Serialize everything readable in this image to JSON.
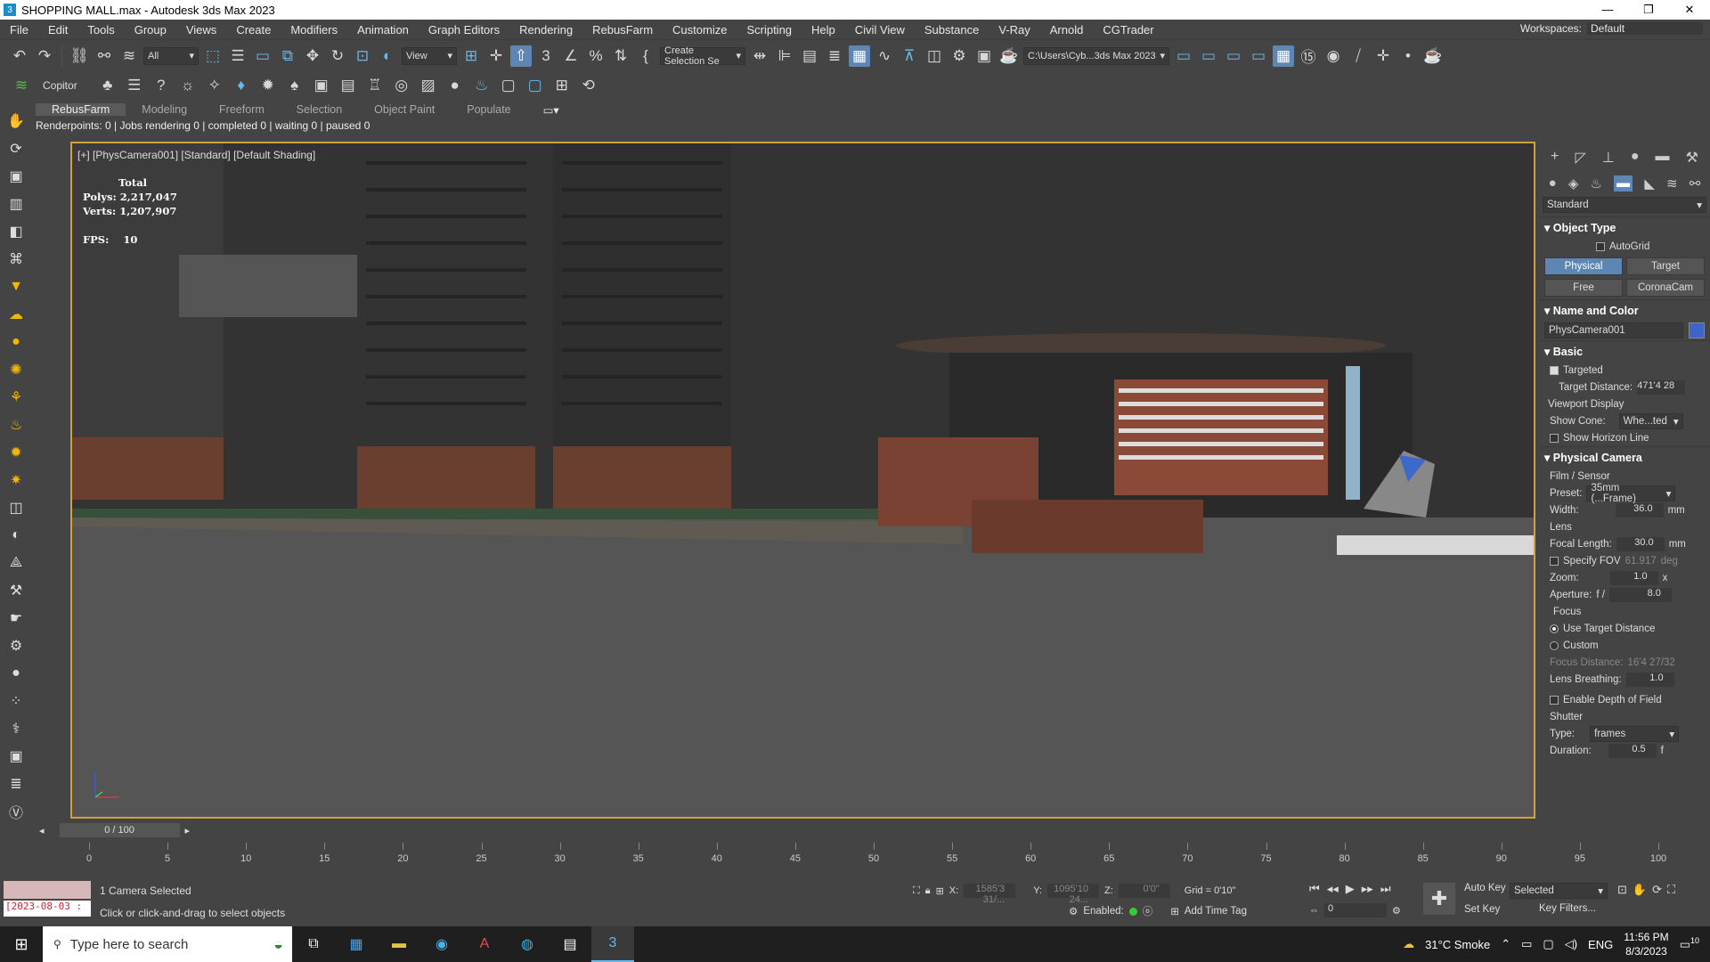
{
  "title_bar": {
    "text": "SHOPPING MALL.max - Autodesk 3ds Max 2023",
    "minimize": "—",
    "maximize": "❐",
    "close": "✕"
  },
  "menu": [
    "File",
    "Edit",
    "Tools",
    "Group",
    "Views",
    "Create",
    "Modifiers",
    "Animation",
    "Graph Editors",
    "Rendering",
    "RebusFarm",
    "Customize",
    "Scripting",
    "Help",
    "Civil View",
    "Substance",
    "V-Ray",
    "Arnold",
    "CGTrader"
  ],
  "workspace": {
    "label": "Workspaces:",
    "value": "Default"
  },
  "toolbar": {
    "filter": "All",
    "ref_coord": "View",
    "selection_set": "Create Selection Se",
    "project_path": "C:\\Users\\Cyb...3ds Max 2023"
  },
  "toolbar2": {
    "copitor": "Copitor"
  },
  "ribbon_tabs": [
    "RebusFarm",
    "Modeling",
    "Freeform",
    "Selection",
    "Object Paint",
    "Populate"
  ],
  "render_status": "Renderpoints: 0 | Jobs rendering 0 | completed 0 | waiting 0 | paused 0",
  "viewport": {
    "label": "[+] [PhysCamera001] [Standard] [Default Shading]",
    "stats_total": "Total",
    "polys_label": "Polys:",
    "polys": "2,217,047",
    "verts_label": "Verts:",
    "verts": "1,207,907",
    "fps_label": "FPS:",
    "fps": "10"
  },
  "cmd": {
    "category": "Standard",
    "object_type": "Object Type",
    "autogrid": "AutoGrid",
    "buttons": [
      "Physical",
      "Target",
      "Free",
      "CoronaCam"
    ],
    "name_color": "Name and Color",
    "name": "PhysCamera001",
    "obj_color": "#3f63c8",
    "basic": "Basic",
    "targeted": "Targeted",
    "target_distance_label": "Target Distance:",
    "target_distance": "471'4 28",
    "viewport_display": "Viewport Display",
    "show_cone_label": "Show Cone:",
    "show_cone": "Whe...ted",
    "show_horizon": "Show Horizon Line",
    "physical_camera": "Physical Camera",
    "film_sensor": "Film / Sensor",
    "preset_label": "Preset:",
    "preset": "35mm (...Frame)",
    "width_label": "Width:",
    "width": "36.0",
    "width_unit": "mm",
    "lens": "Lens",
    "focal_label": "Focal Length:",
    "focal": "30.0",
    "focal_unit": "mm",
    "specify_fov": "Specify FOV",
    "fov": "61.917",
    "fov_unit": "deg",
    "zoom_label": "Zoom:",
    "zoom": "1.0",
    "zoom_unit": "x",
    "aperture_label": "Aperture:",
    "aperture_f": "f /",
    "aperture": "8.0",
    "focus": "Focus",
    "use_target_distance": "Use Target Distance",
    "custom": "Custom",
    "focus_distance_label": "Focus Distance:",
    "focus_distance": "16'4 27/32",
    "lens_breathing_label": "Lens Breathing:",
    "lens_breathing": "1.0",
    "enable_dof": "Enable Depth of Field",
    "shutter": "Shutter",
    "type_label": "Type:",
    "type": "frames",
    "duration_label": "Duration:",
    "duration": "0.5",
    "duration_unit": "f"
  },
  "timeline": {
    "frame": "0 / 100",
    "ticks": [
      "0",
      "5",
      "10",
      "15",
      "20",
      "25",
      "30",
      "35",
      "40",
      "45",
      "50",
      "55",
      "60",
      "65",
      "70",
      "75",
      "80",
      "85",
      "90",
      "95",
      "100"
    ]
  },
  "status": {
    "date_box": "[2023-08-03 :",
    "selected": "1 Camera Selected",
    "hint": "Click or click-and-drag to select objects",
    "x_label": "X:",
    "x": "1585'3 31/...",
    "y_label": "Y:",
    "y": "1095'10 24...",
    "z_label": "Z:",
    "z": "0'0\"",
    "grid": "Grid = 0'10\"",
    "enabled_label": "Enabled:",
    "add_time_tag": "Add Time Tag",
    "auto_key": "Auto Key",
    "set_key": "Set Key",
    "selected_drop": "Selected",
    "key_filters": "Key Filters...",
    "frame_field": "0"
  },
  "taskbar": {
    "search_placeholder": "Type here to search",
    "weather": "31°C  Smoke",
    "lang": "ENG",
    "time": "11:56 PM",
    "date": "8/3/2023",
    "notif": "10"
  }
}
